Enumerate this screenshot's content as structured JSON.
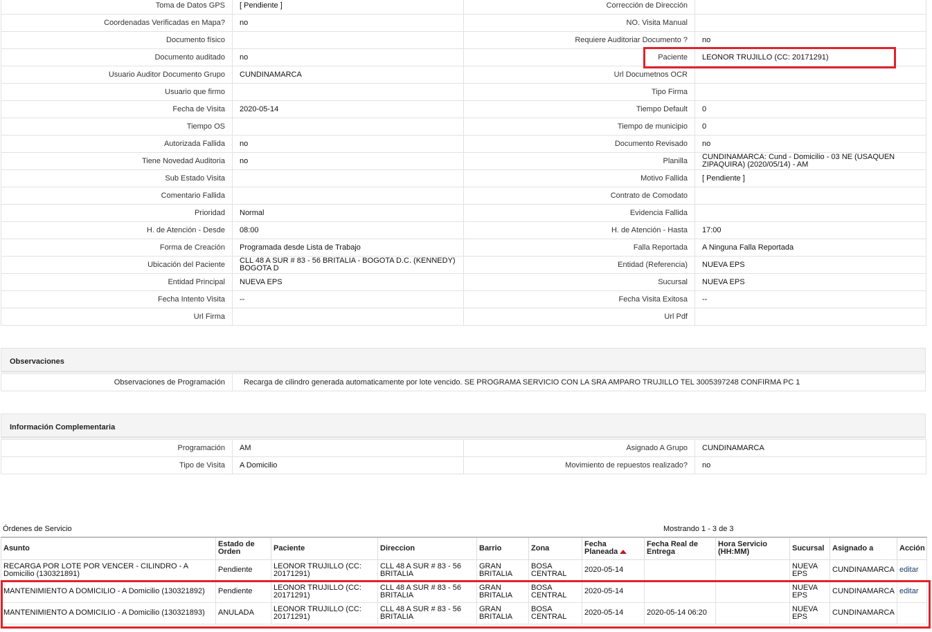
{
  "details": {
    "rows": [
      {
        "l1": "Toma de Datos GPS",
        "v1": "[ Pendiente ]",
        "l2": "Corrección de Dirección",
        "v2": ""
      },
      {
        "l1": "Coordenadas Verificadas en Mapa?",
        "v1": " no",
        "l2": "NO. Visita Manual",
        "v2": ""
      },
      {
        "l1": "Documento físico",
        "v1": "",
        "l2": "Requiere Auditoriar Documento ?",
        "v2": " no"
      },
      {
        "l1": "Documento auditado",
        "v1": " no",
        "l2": "Paciente",
        "v2": "LEONOR TRUJILLO (CC: 20171291)"
      },
      {
        "l1": "Usuario Auditor Documento Grupo",
        "v1": "CUNDINAMARCA",
        "l2": "Url Documetnos OCR",
        "v2": ""
      },
      {
        "l1": "Usuario que firmo",
        "v1": "",
        "l2": "Tipo Firma",
        "v2": ""
      },
      {
        "l1": "Fecha de Visita",
        "v1": " 2020-05-14",
        "l2": "Tiempo Default",
        "v2": "0"
      },
      {
        "l1": "Tiempo OS",
        "v1": "",
        "l2": "Tiempo de municipio",
        "v2": "0"
      },
      {
        "l1": "Autorizada Fallida",
        "v1": " no",
        "l2": "Documento Revisado",
        "v2": " no"
      },
      {
        "l1": "Tiene Novedad Auditoria",
        "v1": " no",
        "l2": "Planilla",
        "v2": "CUNDINAMARCA: Cund - Domicilio - 03 NE (USAQUEN ZIPAQUIRA) (2020/05/14) - AM"
      },
      {
        "l1": "Sub Estado Visita",
        "v1": "",
        "l2": "Motivo Fallida",
        "v2": "[ Pendiente ]"
      },
      {
        "l1": "Comentario Fallida",
        "v1": "",
        "l2": "Contrato de Comodato",
        "v2": ""
      },
      {
        "l1": "Prioridad",
        "v1": "Normal",
        "l2": "Evidencia Fallida",
        "v2": ""
      },
      {
        "l1": "H. de Atención - Desde",
        "v1": "08:00",
        "l2": "H. de Atención - Hasta",
        "v2": "17:00"
      },
      {
        "l1": "Forma de Creación",
        "v1": "Programada desde Lista de Trabajo",
        "l2": "Falla Reportada",
        "v2": "A Ninguna Falla Reportada"
      },
      {
        "l1": "Ubicación del Paciente",
        "v1": "CLL 48 A SUR # 83 - 56 BRITALIA - BOGOTA D.C. (KENNEDY) BOGOTA D",
        "l2": "Entidad (Referencia)",
        "v2": "NUEVA EPS"
      },
      {
        "l1": "Entidad Principal",
        "v1": "NUEVA EPS",
        "l2": "Sucursal",
        "v2": "NUEVA EPS"
      },
      {
        "l1": "Fecha Intento Visita",
        "v1": "--",
        "l2": "Fecha Visita Exitosa",
        "v2": " --"
      },
      {
        "l1": "Url Firma",
        "v1": "",
        "l2": "Url Pdf",
        "v2": ""
      }
    ]
  },
  "observaciones": {
    "title": "Observaciones",
    "label": "Observaciones de Programación",
    "value": "Recarga de cilindro generada automaticamente por lote vencido. SE PROGRAMA SERVICIO CON LA SRA AMPARO TRUJILLO TEL 3005397248 CONFIRMA PC 1"
  },
  "complementaria": {
    "title": "Información Complementaria",
    "rows": [
      {
        "l1": "Programación",
        "v1": "AM",
        "l2": "Asignado A Grupo",
        "v2": "CUNDINAMARCA"
      },
      {
        "l1": "Tipo de Visita",
        "v1": "A Domicilio",
        "l2": "Movimiento de repuestos realizado?",
        "v2": " no"
      }
    ]
  },
  "ordenes": {
    "title": "Órdenes de Servicio",
    "count": "Mostrando 1 - 3 de 3",
    "headers": [
      "Asunto",
      "Estado de Orden",
      "Paciente",
      "Direccion",
      "Barrio",
      "Zona",
      "Fecha Planeada",
      "Fecha Real de Entrega",
      "Hora Servicio (HH:MM)",
      "Sucursal",
      "Asignado a",
      "Acción"
    ],
    "rows": [
      {
        "asunto": "RECARGA POR LOTE POR VENCER - CILINDRO - A Domicilio (130321891)",
        "estado": "Pendiente",
        "paciente": "LEONOR TRUJILLO (CC: 20171291)",
        "direccion": "CLL 48 A SUR # 83 - 56 BRITALIA",
        "barrio": "GRAN BRITALIA",
        "zona": "BOSA CENTRAL",
        "fecha_planeada": "2020-05-14",
        "fecha_real": "",
        "hora": "",
        "sucursal": "NUEVA EPS",
        "asignado": "CUNDINAMARCA",
        "accion": "editar"
      },
      {
        "asunto": "MANTENIMIENTO A DOMICILIO - A Domicilio (130321892)",
        "estado": "Pendiente",
        "paciente": "LEONOR TRUJILLO (CC: 20171291)",
        "direccion": "CLL 48 A SUR # 83 - 56 BRITALIA",
        "barrio": "GRAN BRITALIA",
        "zona": "BOSA CENTRAL",
        "fecha_planeada": "2020-05-14",
        "fecha_real": "",
        "hora": "",
        "sucursal": "NUEVA EPS",
        "asignado": "CUNDINAMARCA",
        "accion": "editar"
      },
      {
        "asunto": "MANTENIMIENTO A DOMICILIO - A Domicilio (130321893)",
        "estado": "ANULADA",
        "paciente": "LEONOR TRUJILLO (CC: 20171291)",
        "direccion": "CLL 48 A SUR # 83 - 56 BRITALIA",
        "barrio": "GRAN BRITALIA",
        "zona": "BOSA CENTRAL",
        "fecha_planeada": "2020-05-14",
        "fecha_real": "2020-05-14 06:20",
        "hora": "",
        "sucursal": "NUEVA EPS",
        "asignado": "CUNDINAMARCA",
        "accion": ""
      }
    ]
  },
  "colors": {
    "highlight": "#e0222d",
    "sort_arrow": "#b81c1c",
    "link": "#1b3a6b"
  }
}
